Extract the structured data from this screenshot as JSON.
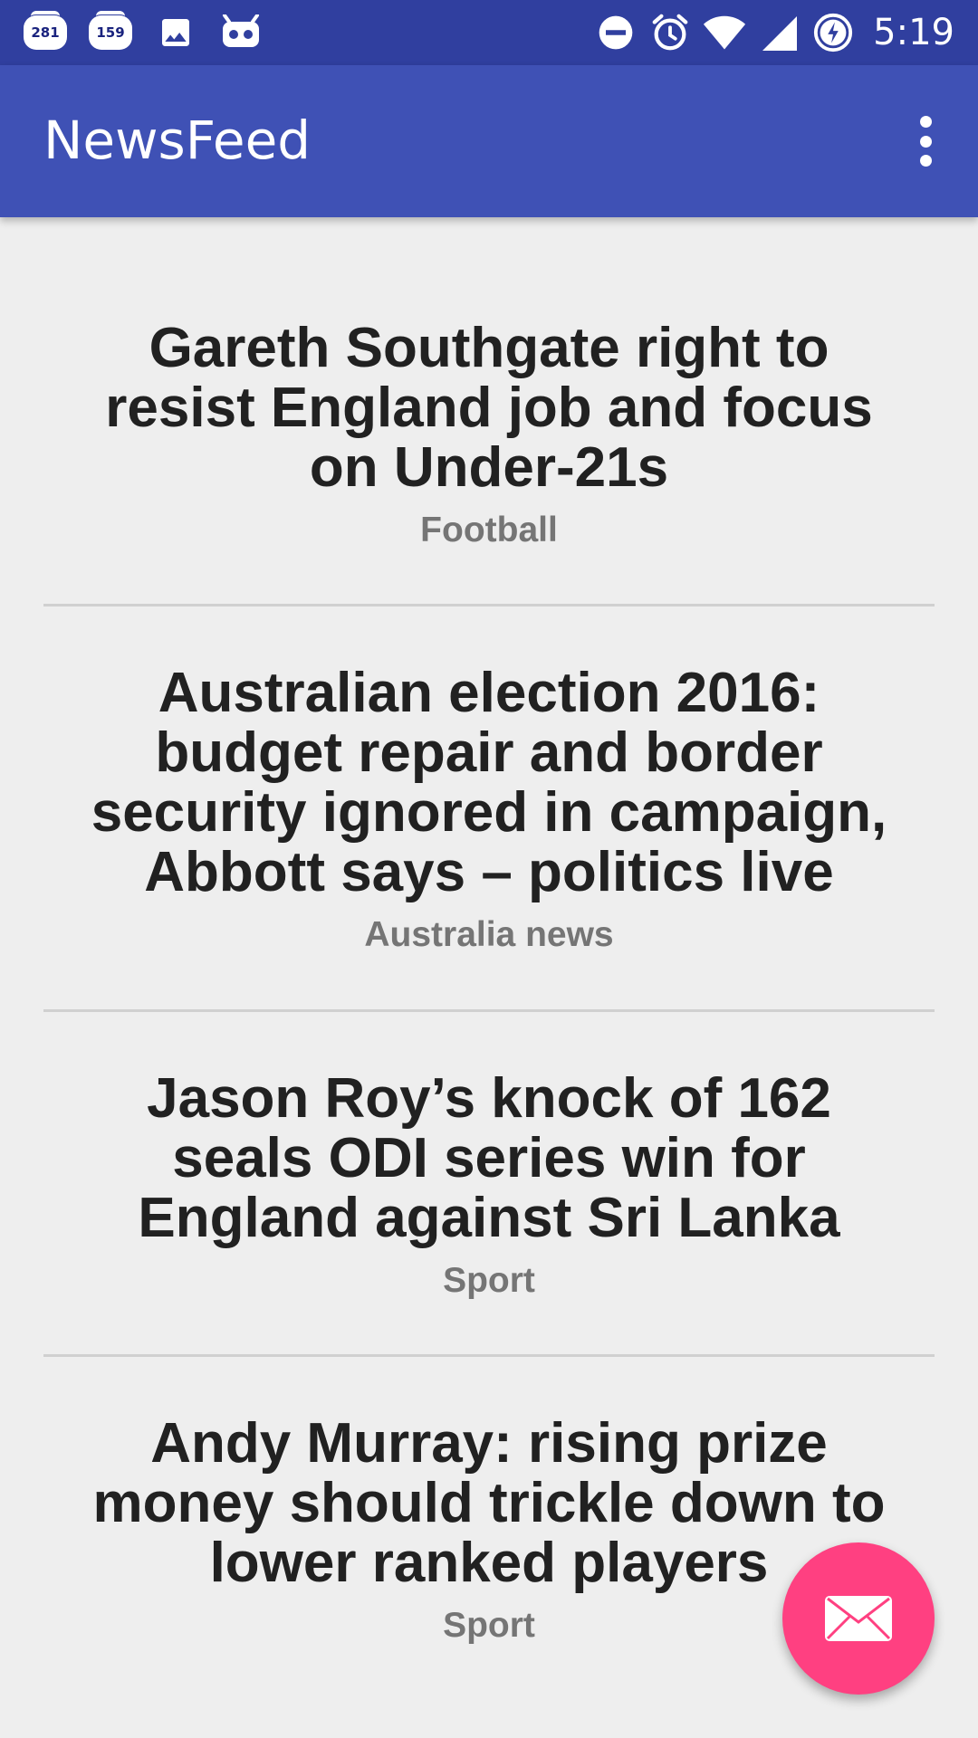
{
  "status_bar": {
    "notifications": [
      {
        "icon": "calendar-badge-icon",
        "count": "281"
      },
      {
        "icon": "calendar-badge-icon",
        "count": "159"
      }
    ],
    "extra_icons": [
      "image-icon",
      "robot-icon"
    ],
    "right_icons": [
      "do-not-disturb-icon",
      "alarm-icon",
      "wifi-icon",
      "signal-icon",
      "battery-saver-icon"
    ],
    "time": "5:19"
  },
  "app_bar": {
    "title": "NewsFeed",
    "overflow_icon": "more-vert-icon"
  },
  "feed": [
    {
      "headline": "Gareth Southgate right to resist England job and focus on Under-21s",
      "section": "Football"
    },
    {
      "headline": "Australian election 2016: budget repair and border security ignored in campaign, Abbott says – politics live",
      "section": "Australia news"
    },
    {
      "headline": "Jason Roy’s knock of 162 seals ODI series win for England against Sri Lanka",
      "section": "Sport"
    },
    {
      "headline": "Andy Murray: rising prize money should trickle down to lower ranked players",
      "section": "Sport"
    }
  ],
  "fab": {
    "icon": "email-icon"
  },
  "colors": {
    "status_bar": "#303f9f",
    "app_bar": "#3f51b5",
    "fab": "#ff4081",
    "background": "#eeeeee",
    "headline": "#212121",
    "section": "#757575"
  }
}
